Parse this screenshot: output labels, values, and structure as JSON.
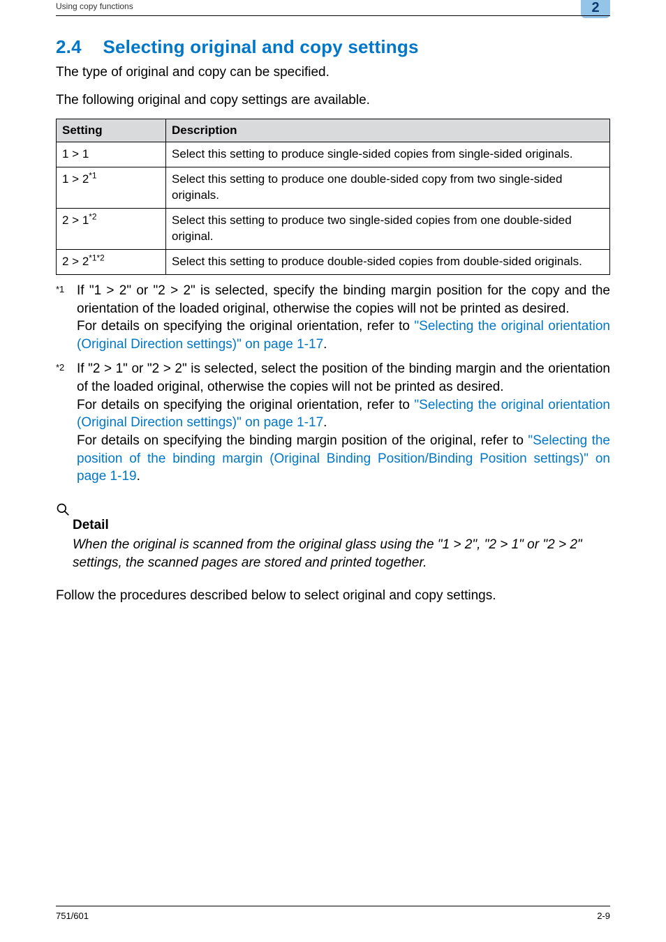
{
  "header": {
    "running_head": "Using copy functions",
    "chapter_tab": "2"
  },
  "section": {
    "number": "2.4",
    "title": "Selecting original and copy settings"
  },
  "intro": {
    "p1": "The type of original and copy can be specified.",
    "p2": "The following original and copy settings are available."
  },
  "table": {
    "headers": {
      "col1": "Setting",
      "col2": "Description"
    },
    "rows": [
      {
        "setting": "1 > 1",
        "sup": "",
        "desc": "Select this setting to produce single-sided copies from single-sided originals."
      },
      {
        "setting": "1 > 2",
        "sup": "*1",
        "desc": "Select this setting to produce one double-sided copy from two single-sided originals."
      },
      {
        "setting": "2 > 1",
        "sup": "*2",
        "desc": "Select this setting to produce two single-sided copies from one double-sided original."
      },
      {
        "setting": "2 > 2",
        "sup": "*1*2",
        "desc": "Select this setting to produce double-sided copies from double-sided originals."
      }
    ]
  },
  "footnotes": {
    "fn1": {
      "marker": "*1",
      "text_a": "If \"1 > 2\" or \"2 > 2\" is selected, specify the binding margin position for the copy and the orientation of the loaded original, otherwise the copies will not be printed as desired.",
      "text_b_prefix": "For details on specifying the original orientation, refer to ",
      "link_b": "\"Selecting the original orientation (Original Direction settings)\" on page 1-17",
      "text_b_suffix": "."
    },
    "fn2": {
      "marker": "*2",
      "text_a": "If \"2 > 1\" or \"2 > 2\" is selected, select the position of the binding margin and the orientation of the loaded original, otherwise the copies will not be printed as desired.",
      "text_b_prefix": "For details on specifying the original orientation, refer to ",
      "link_b": "\"Selecting the original orientation (Original Direction settings)\" on page 1-17",
      "text_b_suffix": ".",
      "text_c_prefix": "For details on specifying the binding margin position of the original, refer to ",
      "link_c": "\"Selecting the position of the binding margin (Original Binding Position/Binding Position settings)\" on page 1-19",
      "text_c_suffix": "."
    }
  },
  "detail": {
    "label": "Detail",
    "body": "When the original is scanned from the original glass using the \"1 > 2\", \"2 > 1\" or \"2 > 2\" settings, the scanned pages are stored and printed together."
  },
  "closing": "Follow the procedures described below to select original and copy settings.",
  "footer": {
    "left": "751/601",
    "right": "2-9"
  }
}
